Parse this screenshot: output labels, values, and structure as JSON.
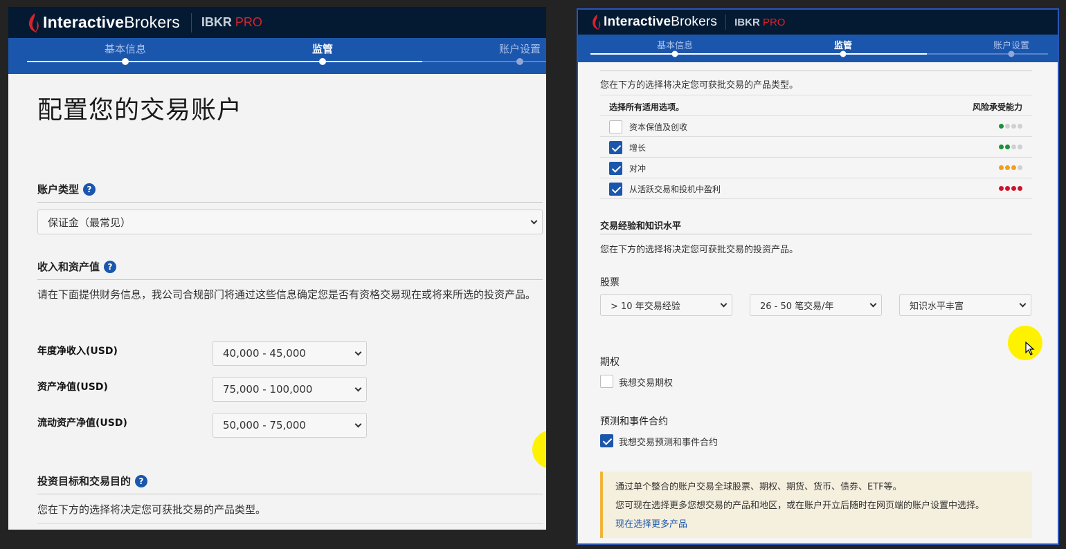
{
  "brand": {
    "logo_main": "Interactive",
    "logo_sub": "Brokers",
    "product_main": "IBKR ",
    "product_accent": "PRO"
  },
  "steps": [
    "基本信息",
    "监管",
    "账户设置"
  ],
  "left": {
    "page_title": "配置您的交易账户",
    "account_type": {
      "title": "账户类型",
      "help": "?",
      "selected": "保证金（最常见）"
    },
    "income": {
      "title": "收入和资产值",
      "help": "?",
      "description": "请在下面提供财务信息，我公司合规部门将通过这些信息确定您是否有资格交易现在或将来所选的投资产品。",
      "fields": [
        {
          "label": "年度净收入(USD)",
          "value": "40,000 - 45,000"
        },
        {
          "label": "资产净值(USD)",
          "value": "75,000 - 100,000"
        },
        {
          "label": "流动资产净值(USD)",
          "value": "50,000 - 75,000"
        }
      ]
    },
    "objectives": {
      "title": "投资目标和交易目的",
      "help": "?",
      "description": "您在下方的选择将决定您可获批交易的产品类型。"
    }
  },
  "right": {
    "objectives_description": "您在下方的选择将决定您可获批交易的产品类型。",
    "table": {
      "col_select": "选择所有适用选项。",
      "col_risk": "风险承受能力",
      "rows": [
        {
          "label": "资本保值及创收",
          "checked": false,
          "risk_level": 1,
          "risk_color": "#1e8f3a"
        },
        {
          "label": "增长",
          "checked": true,
          "risk_level": 2,
          "risk_color": "#1e8f3a"
        },
        {
          "label": "对冲",
          "checked": true,
          "risk_level": 3,
          "risk_color": "#f0a020"
        },
        {
          "label": "从活跃交易和投机中盈利",
          "checked": true,
          "risk_level": 4,
          "risk_color": "#d0132c"
        }
      ]
    },
    "experience": {
      "title": "交易经验和知识水平",
      "description": "您在下方的选择将决定您可获批交易的投资产品。",
      "stocks": {
        "title": "股票",
        "years": "> 10 年交易经验",
        "trades": "26 - 50 笔交易/年",
        "knowledge": "知识水平丰富"
      },
      "options": {
        "title": "期权",
        "checkbox_label": "我想交易期权",
        "checked": false
      },
      "prediction": {
        "title": "预测和事件合约",
        "checkbox_label": "我想交易预测和事件合约",
        "checked": true
      }
    },
    "notice": {
      "line1": "通过单个整合的账户交易全球股票、期权、期货、货币、债券、ETF等。",
      "line2": "您可现在选择更多您想交易的产品和地区，或在账户开立后随时在网页端的账户设置中选择。",
      "link": "现在选择更多产品"
    }
  },
  "colors": {
    "brand_navy": "#041a33",
    "step_blue": "#1b56ad",
    "check_blue": "#1b56ad",
    "cursor_highlight": "#fff200",
    "notice_bg": "#f5efde"
  }
}
